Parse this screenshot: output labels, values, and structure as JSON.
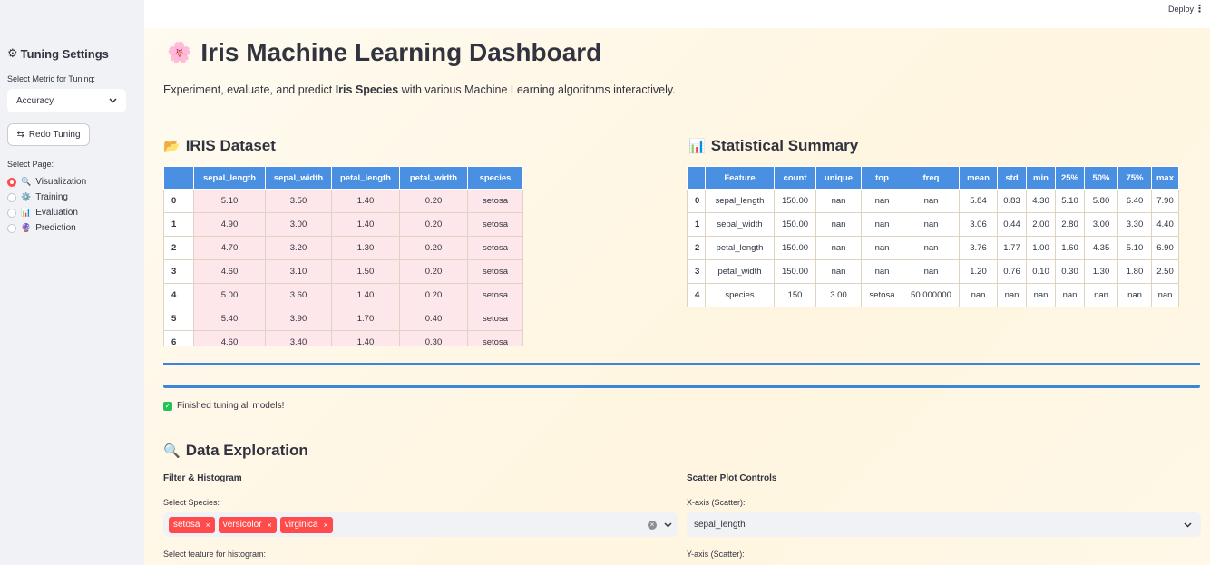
{
  "sidebar": {
    "title_icon": "⚙",
    "title": "Tuning Settings",
    "metric_label": "Select Metric for Tuning:",
    "metric_value": "Accuracy",
    "redo_icon": "⇆",
    "redo_label": "Redo Tuning",
    "page_label": "Select Page:",
    "pages": [
      {
        "emoji": "🔍",
        "label": "Visualization",
        "selected": true
      },
      {
        "emoji": "⚙️",
        "label": "Training",
        "selected": false
      },
      {
        "emoji": "📊",
        "label": "Evaluation",
        "selected": false
      },
      {
        "emoji": "🔮",
        "label": "Prediction",
        "selected": false
      }
    ]
  },
  "topbar": {
    "deploy_label": "Deploy",
    "menu_icon": "⋮"
  },
  "main": {
    "title_emoji": "🌸",
    "title": "Iris Machine Learning Dashboard",
    "subtitle_pre": "Experiment, evaluate, and predict ",
    "subtitle_bold": "Iris Species",
    "subtitle_post": " with various Machine Learning algorithms interactively.",
    "dataset_icon": "📂",
    "dataset_heading": "IRIS Dataset",
    "stats_icon": "📊",
    "stats_heading": "Statistical Summary",
    "status_text": "Finished tuning all models!",
    "explore_icon": "🔍",
    "explore_heading": "Data Exploration",
    "filter_heading": "Filter & Histogram",
    "species_label": "Select Species:",
    "species_tags": [
      "setosa",
      "versicolor",
      "virginica"
    ],
    "hist_label": "Select feature for histogram:",
    "scatter_heading": "Scatter Plot Controls",
    "xaxis_label": "X-axis (Scatter):",
    "xaxis_value": "sepal_length",
    "yaxis_label": "Y-axis (Scatter):"
  },
  "iris_table": {
    "columns": [
      "",
      "sepal_length",
      "sepal_width",
      "petal_length",
      "petal_width",
      "species"
    ],
    "rows": [
      [
        "0",
        "5.10",
        "3.50",
        "1.40",
        "0.20",
        "setosa"
      ],
      [
        "1",
        "4.90",
        "3.00",
        "1.40",
        "0.20",
        "setosa"
      ],
      [
        "2",
        "4.70",
        "3.20",
        "1.30",
        "0.20",
        "setosa"
      ],
      [
        "3",
        "4.60",
        "3.10",
        "1.50",
        "0.20",
        "setosa"
      ],
      [
        "4",
        "5.00",
        "3.60",
        "1.40",
        "0.20",
        "setosa"
      ],
      [
        "5",
        "5.40",
        "3.90",
        "1.70",
        "0.40",
        "setosa"
      ],
      [
        "6",
        "4.60",
        "3.40",
        "1.40",
        "0.30",
        "setosa"
      ]
    ]
  },
  "stats_table": {
    "columns": [
      "",
      "Feature",
      "count",
      "unique",
      "top",
      "freq",
      "mean",
      "std",
      "min",
      "25%",
      "50%",
      "75%",
      "max"
    ],
    "rows": [
      [
        "0",
        "sepal_length",
        "150.00",
        "nan",
        "nan",
        "nan",
        "5.84",
        "0.83",
        "4.30",
        "5.10",
        "5.80",
        "6.40",
        "7.90"
      ],
      [
        "1",
        "sepal_width",
        "150.00",
        "nan",
        "nan",
        "nan",
        "3.06",
        "0.44",
        "2.00",
        "2.80",
        "3.00",
        "3.30",
        "4.40"
      ],
      [
        "2",
        "petal_length",
        "150.00",
        "nan",
        "nan",
        "nan",
        "3.76",
        "1.77",
        "1.00",
        "1.60",
        "4.35",
        "5.10",
        "6.90"
      ],
      [
        "3",
        "petal_width",
        "150.00",
        "nan",
        "nan",
        "nan",
        "1.20",
        "0.76",
        "0.10",
        "0.30",
        "1.30",
        "1.80",
        "2.50"
      ],
      [
        "4",
        "species",
        "150",
        "3.00",
        "setosa",
        "50.000000",
        "nan",
        "nan",
        "nan",
        "nan",
        "nan",
        "nan",
        "nan"
      ]
    ]
  }
}
